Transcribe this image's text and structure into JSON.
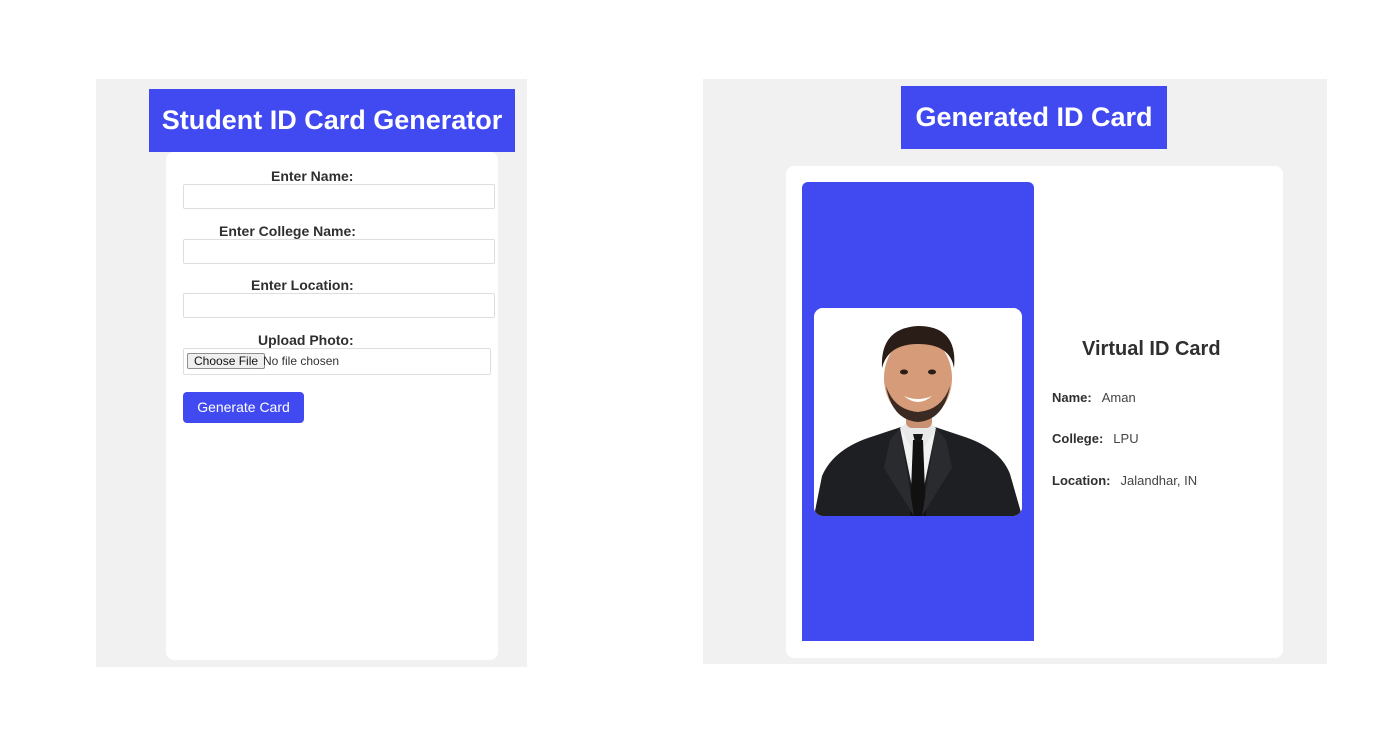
{
  "generator": {
    "title": "Student ID Card Generator",
    "form": {
      "name_label": "Enter Name:",
      "name_value": "",
      "college_label": "Enter College Name:",
      "college_value": "",
      "location_label": "Enter Location:",
      "location_value": "",
      "photo_label": "Upload Photo:",
      "choose_file_label": "Choose File",
      "file_status": "No file chosen",
      "generate_label": "Generate Card"
    }
  },
  "preview": {
    "title": "Generated ID Card",
    "card": {
      "heading": "Virtual ID Card",
      "fields": [
        {
          "label": "Name:",
          "value": "Aman"
        },
        {
          "label": "College:",
          "value": "LPU"
        },
        {
          "label": "Location:",
          "value": "Jalandhar, IN"
        }
      ],
      "photo_icon": "student-photo-icon"
    }
  },
  "colors": {
    "accent": "#4149f1",
    "panel_background": "#f1f1f1",
    "card_background": "#ffffff"
  }
}
